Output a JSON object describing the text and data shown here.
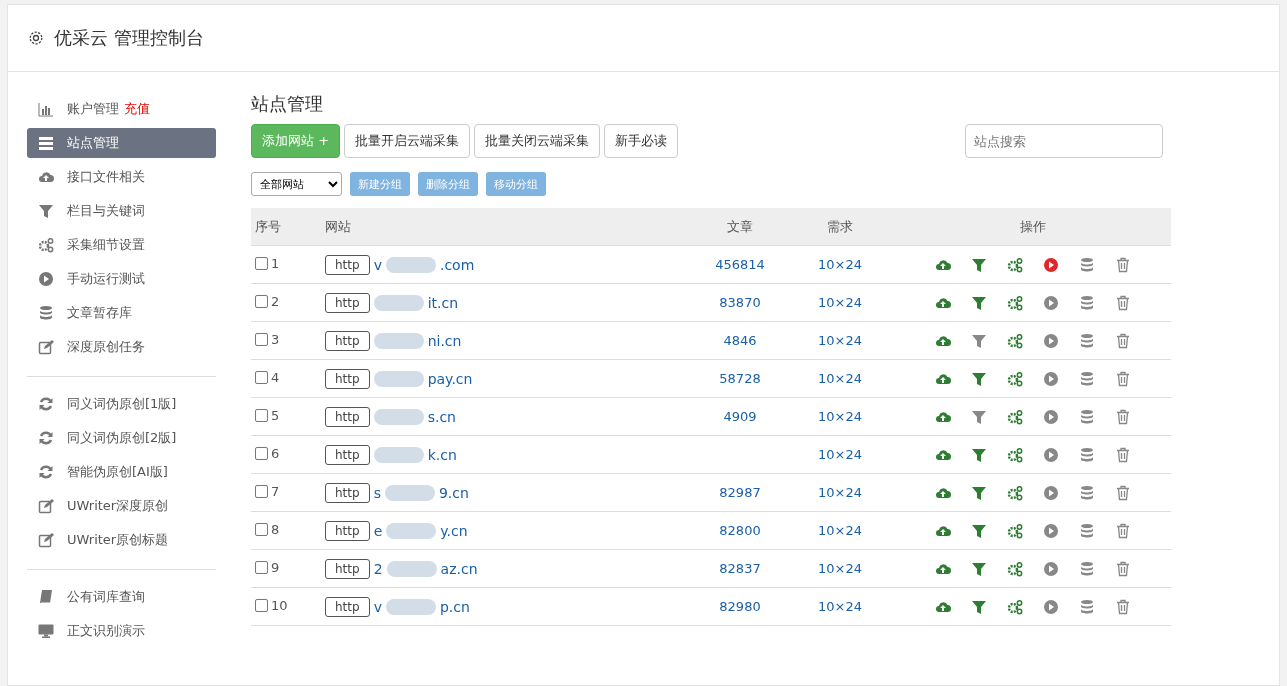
{
  "header": {
    "title": "优采云 管理控制台"
  },
  "sidebar": {
    "groups": [
      [
        {
          "kind": "chart",
          "label": "账户管理",
          "badge": "充值",
          "selected": false
        },
        {
          "kind": "server",
          "label": "站点管理",
          "selected": true
        },
        {
          "kind": "cloud",
          "label": "接口文件相关",
          "selected": false
        },
        {
          "kind": "filter",
          "label": "栏目与关键词",
          "selected": false
        },
        {
          "kind": "gears",
          "label": "采集细节设置",
          "selected": false
        },
        {
          "kind": "play",
          "label": "手动运行测试",
          "selected": false
        },
        {
          "kind": "database",
          "label": "文章暂存库",
          "selected": false
        },
        {
          "kind": "edit",
          "label": "深度原创任务",
          "selected": false
        }
      ],
      [
        {
          "kind": "refresh",
          "label": "同义词伪原创[1版]",
          "selected": false
        },
        {
          "kind": "refresh",
          "label": "同义词伪原创[2版]",
          "selected": false
        },
        {
          "kind": "refresh",
          "label": "智能伪原创[AI版]",
          "selected": false
        },
        {
          "kind": "edit",
          "label": "UWriter深度原创",
          "selected": false
        },
        {
          "kind": "edit",
          "label": "UWriter原创标题",
          "selected": false
        }
      ],
      [
        {
          "kind": "book",
          "label": "公有词库查询",
          "selected": false
        },
        {
          "kind": "monitor",
          "label": "正文识别演示",
          "selected": false
        }
      ]
    ]
  },
  "main": {
    "title": "站点管理",
    "toolbar": [
      {
        "kind": "primary",
        "label": "添加网站 +"
      },
      {
        "kind": "default",
        "label": "批量开启云端采集"
      },
      {
        "kind": "default",
        "label": "批量关闭云端采集"
      },
      {
        "kind": "default",
        "label": "新手必读"
      }
    ],
    "search": {
      "placeholder": "站点搜索"
    },
    "group_select": {
      "value": "全部网站"
    },
    "group_buttons": [
      "新建分组",
      "删除分组",
      "移动分组"
    ],
    "table": {
      "columns": [
        "序号",
        "网站",
        "文章",
        "需求",
        "操作"
      ],
      "rows": [
        {
          "no": "1",
          "checked": false,
          "scheme": "http",
          "site_start": "v",
          "site_end": ".com",
          "articles": "456814",
          "demand": "10×24",
          "filter_on": true,
          "running": true
        },
        {
          "no": "2",
          "checked": false,
          "scheme": "http",
          "site_end": "it.cn",
          "articles": "83870",
          "demand": "10×24",
          "filter_on": true,
          "running": false
        },
        {
          "no": "3",
          "checked": false,
          "scheme": "http",
          "site_end": "ni.cn",
          "articles": "4846",
          "demand": "10×24",
          "filter_on": false,
          "running": false
        },
        {
          "no": "4",
          "checked": false,
          "scheme": "http",
          "site_end": "pay.cn",
          "articles": "58728",
          "demand": "10×24",
          "filter_on": true,
          "running": false
        },
        {
          "no": "5",
          "checked": false,
          "scheme": "http",
          "site_end": "s.cn",
          "articles": "4909",
          "demand": "10×24",
          "filter_on": false,
          "running": false
        },
        {
          "no": "6",
          "checked": false,
          "scheme": "http",
          "site_end": "k.cn",
          "demand": "10×24",
          "filter_on": true,
          "running": false
        },
        {
          "no": "7",
          "checked": false,
          "scheme": "http",
          "site_start": "s",
          "site_end": "9.cn",
          "articles": "82987",
          "demand": "10×24",
          "filter_on": true,
          "running": false
        },
        {
          "no": "8",
          "checked": false,
          "scheme": "http",
          "site_start": "e",
          "site_end": "y.cn",
          "articles": "82800",
          "demand": "10×24",
          "filter_on": true,
          "running": false
        },
        {
          "no": "9",
          "checked": false,
          "scheme": "http",
          "site_start": "2",
          "site_end": "az.cn",
          "articles": "82837",
          "demand": "10×24",
          "filter_on": true,
          "running": false
        },
        {
          "no": "10",
          "checked": false,
          "scheme": "http",
          "site_start": "v",
          "site_end": "p.cn",
          "articles": "82980",
          "demand": "10×24",
          "filter_on": true,
          "running": false
        }
      ]
    }
  }
}
